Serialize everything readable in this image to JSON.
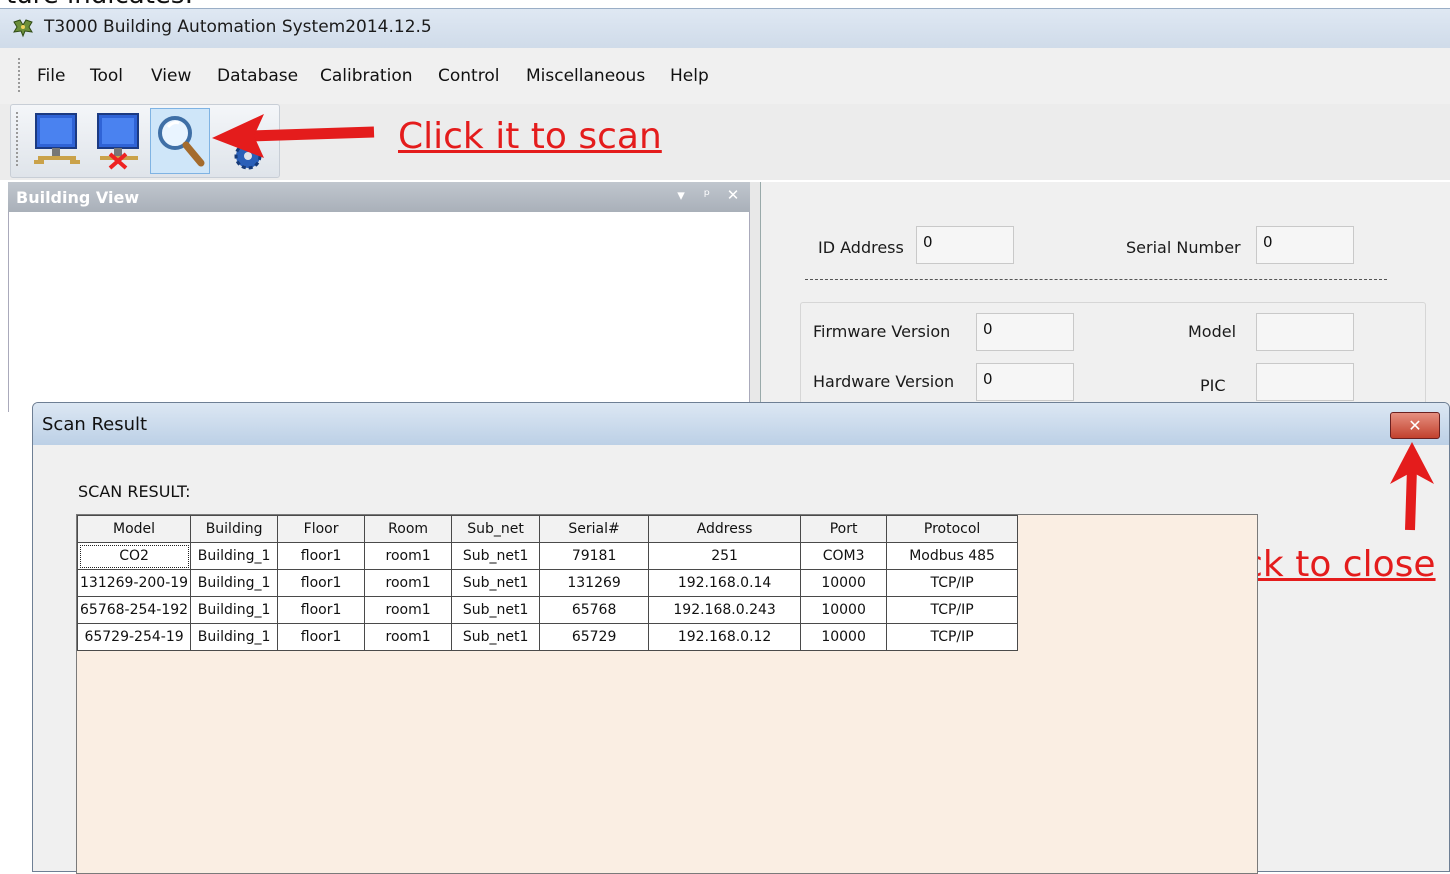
{
  "caption_top": "ture indicates:",
  "window": {
    "title": "T3000 Building Automation System2014.12.5"
  },
  "menu": [
    "File",
    "Tool",
    "View",
    "Database",
    "Calibration",
    "Control",
    "Miscellaneous",
    "Help"
  ],
  "toolbar": {
    "buttons": [
      {
        "name": "connect-button",
        "icon": "network-computer-icon"
      },
      {
        "name": "disconnect-button",
        "icon": "disconnected-computer-icon"
      },
      {
        "name": "scan-button",
        "icon": "magnifier-icon"
      }
    ]
  },
  "annotations": {
    "scan": "Click it to scan",
    "close": "Click to close"
  },
  "building_view": {
    "title": "Building View",
    "controls": [
      "▾",
      "ᵖ",
      "✕"
    ]
  },
  "properties": {
    "id_address_label": "ID Address",
    "id_address_value": "0",
    "serial_number_label": "Serial Number",
    "serial_number_value": "0",
    "firmware_version_label": "Firmware Version",
    "firmware_version_value": "0",
    "model_label": "Model",
    "model_value": "",
    "hardware_version_label": "Hardware Version",
    "hardware_version_value": "0",
    "pic_label": "PIC",
    "pic_value": ""
  },
  "scan_dialog": {
    "title": "Scan Result",
    "close_label": "✕",
    "heading": "SCAN RESULT:",
    "columns": [
      "Model",
      "Building",
      "Floor",
      "Room",
      "Sub_net",
      "Serial#",
      "Address",
      "Port",
      "Protocol"
    ],
    "rows": [
      [
        "CO2",
        "Building_1",
        "floor1",
        "room1",
        "Sub_net1",
        "79181",
        "251",
        "COM3",
        "Modbus 485"
      ],
      [
        "131269-200-19",
        "Building_1",
        "floor1",
        "room1",
        "Sub_net1",
        "131269",
        "192.168.0.14",
        "10000",
        "TCP/IP"
      ],
      [
        "65768-254-192",
        "Building_1",
        "floor1",
        "room1",
        "Sub_net1",
        "65768",
        "192.168.0.243",
        "10000",
        "TCP/IP"
      ],
      [
        "65729-254-19",
        "Building_1",
        "floor1",
        "room1",
        "Sub_net1",
        "65729",
        "192.168.0.12",
        "10000",
        "TCP/IP"
      ]
    ]
  },
  "colors": {
    "annotation": "#e41c1c",
    "grid_background": "#faeee3",
    "close_button": "#c2412e"
  }
}
